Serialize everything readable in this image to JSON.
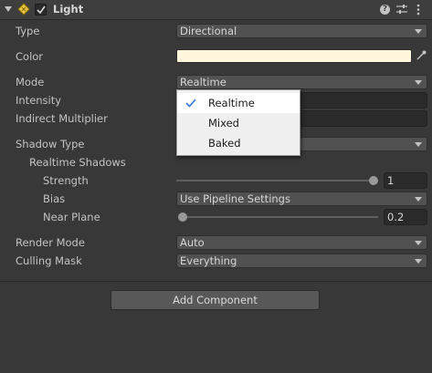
{
  "header": {
    "title": "Light",
    "component_enabled": true,
    "icons": [
      "foldout-arrow-icon",
      "light-bulb-icon",
      "help-icon",
      "preset-icon",
      "component-menu-icon"
    ]
  },
  "props": {
    "type": {
      "label": "Type",
      "value": "Directional"
    },
    "color": {
      "label": "Color",
      "value_hex": "#fff6db"
    },
    "mode": {
      "label": "Mode",
      "value": "Realtime"
    },
    "intensity": {
      "label": "Intensity"
    },
    "indirect": {
      "label": "Indirect Multiplier"
    },
    "shadow_type": {
      "label": "Shadow Type"
    },
    "realtime_shadows": {
      "label": "Realtime Shadows"
    },
    "strength": {
      "label": "Strength",
      "value": "1",
      "slider_fraction": 1.0
    },
    "bias": {
      "label": "Bias",
      "value": "Use Pipeline Settings"
    },
    "near_plane": {
      "label": "Near Plane",
      "value": "0.2",
      "slider_fraction": 0.0
    },
    "render_mode": {
      "label": "Render Mode",
      "value": "Auto"
    },
    "culling_mask": {
      "label": "Culling Mask",
      "value": "Everything"
    }
  },
  "mode_popup": {
    "options": [
      {
        "label": "Realtime",
        "checked": true
      },
      {
        "label": "Mixed",
        "checked": false
      },
      {
        "label": "Baked",
        "checked": false
      }
    ]
  },
  "add_component": {
    "label": "Add Component"
  },
  "colors": {
    "background": "#383838",
    "popup": "#f0f0f0",
    "check": "#3a7bd5"
  }
}
